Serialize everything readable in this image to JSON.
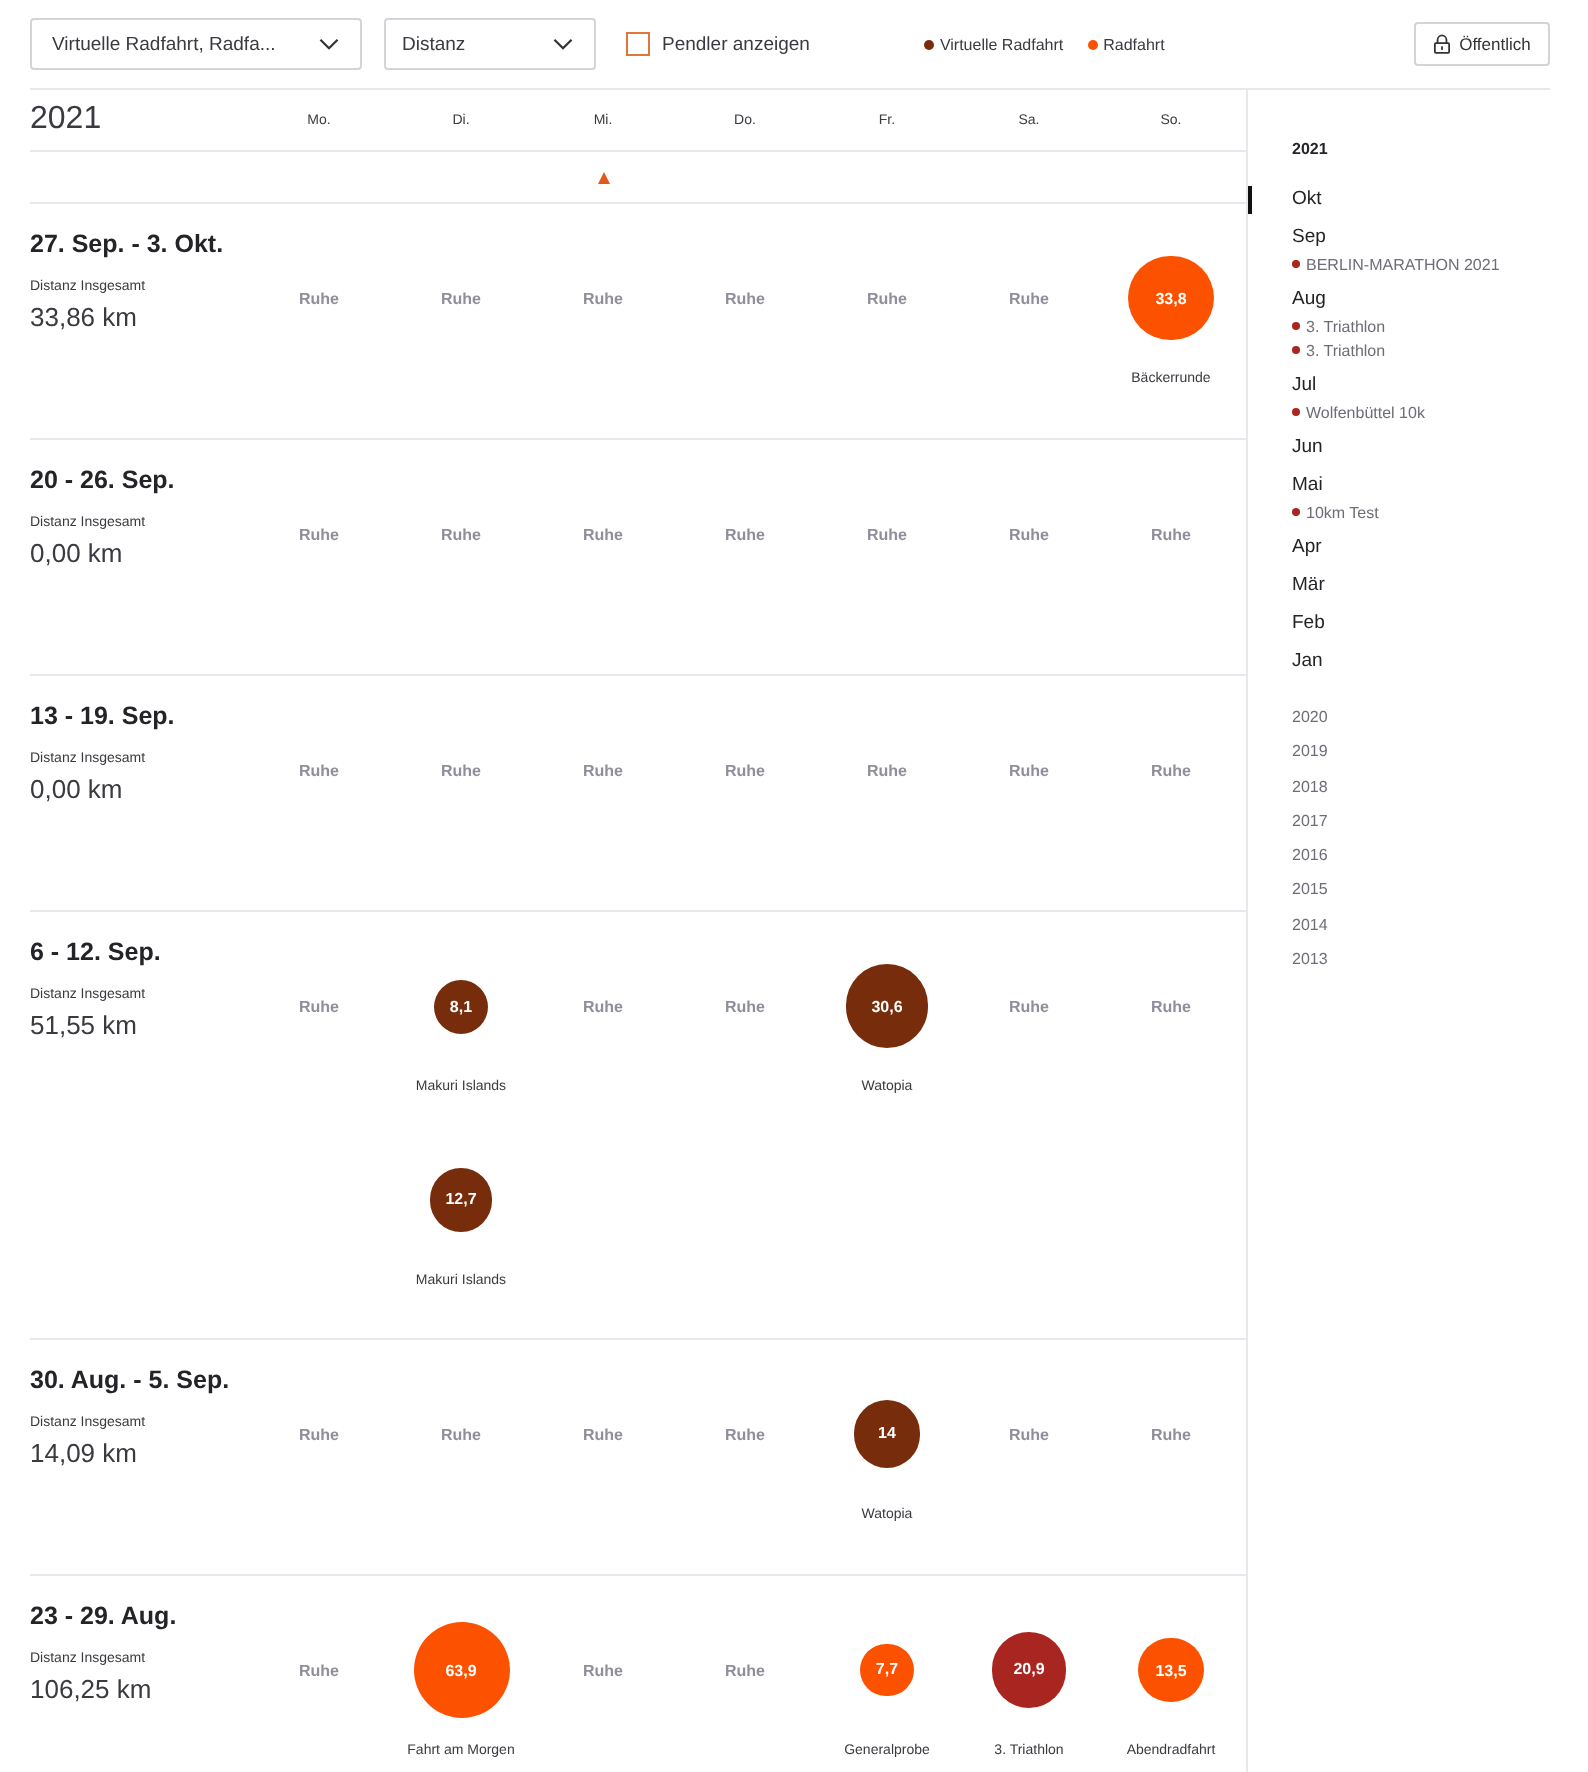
{
  "filters": {
    "activity_type": {
      "value": "Virtuelle Radfahrt, Radfa..."
    },
    "metric": {
      "value": "Distanz"
    },
    "commute": {
      "label": "Pendler anzeigen",
      "checked": false
    }
  },
  "legend": [
    {
      "label": "Virtuelle Radfahrt",
      "color": "#772d0b"
    },
    {
      "label": "Radfahrt",
      "color": "#fc5200"
    }
  ],
  "visibility_button": {
    "label": "Öffentlich"
  },
  "calendar": {
    "year": "2021",
    "weekdays": [
      {
        "label": "Mo.",
        "today": false
      },
      {
        "label": "Di.",
        "today": false
      },
      {
        "label": "Mi.",
        "today": true
      },
      {
        "label": "Do.",
        "today": false
      },
      {
        "label": "Fr.",
        "today": false
      },
      {
        "label": "Sa.",
        "today": false
      },
      {
        "label": "So.",
        "today": false
      }
    ],
    "weeks": [
      {
        "title": "27. Sep. - 3. Okt.",
        "total_label": "Distanz Insgesamt",
        "total": "33,86 km",
        "days": [
          {
            "kind": "rest",
            "label": "Ruhe"
          },
          {
            "kind": "rest",
            "label": "Ruhe"
          },
          {
            "kind": "rest",
            "label": "Ruhe"
          },
          {
            "kind": "rest",
            "label": "Ruhe"
          },
          {
            "kind": "rest",
            "label": "Ruhe"
          },
          {
            "kind": "rest",
            "label": "Ruhe"
          },
          {
            "kind": "activities",
            "activities": [
              {
                "value": "33,8",
                "name": "Bäckerrunde",
                "color": "#fc5200"
              }
            ]
          }
        ]
      },
      {
        "title": "20 - 26. Sep.",
        "total_label": "Distanz Insgesamt",
        "total": "0,00 km",
        "days": [
          {
            "kind": "rest",
            "label": "Ruhe"
          },
          {
            "kind": "rest",
            "label": "Ruhe"
          },
          {
            "kind": "rest",
            "label": "Ruhe"
          },
          {
            "kind": "rest",
            "label": "Ruhe"
          },
          {
            "kind": "rest",
            "label": "Ruhe"
          },
          {
            "kind": "rest",
            "label": "Ruhe"
          },
          {
            "kind": "rest",
            "label": "Ruhe"
          }
        ]
      },
      {
        "title": "13 - 19. Sep.",
        "total_label": "Distanz Insgesamt",
        "total": "0,00 km",
        "days": [
          {
            "kind": "rest",
            "label": "Ruhe"
          },
          {
            "kind": "rest",
            "label": "Ruhe"
          },
          {
            "kind": "rest",
            "label": "Ruhe"
          },
          {
            "kind": "rest",
            "label": "Ruhe"
          },
          {
            "kind": "rest",
            "label": "Ruhe"
          },
          {
            "kind": "rest",
            "label": "Ruhe"
          },
          {
            "kind": "rest",
            "label": "Ruhe"
          }
        ]
      },
      {
        "title": "6 - 12. Sep.",
        "total_label": "Distanz Insgesamt",
        "total": "51,55 km",
        "days": [
          {
            "kind": "rest",
            "label": "Ruhe"
          },
          {
            "kind": "activities",
            "activities": [
              {
                "value": "8,1",
                "name": "Makuri Islands",
                "color": "#772d0b"
              },
              {
                "value": "12,7",
                "name": "Makuri Islands",
                "color": "#772d0b"
              }
            ]
          },
          {
            "kind": "rest",
            "label": "Ruhe"
          },
          {
            "kind": "rest",
            "label": "Ruhe"
          },
          {
            "kind": "activities",
            "activities": [
              {
                "value": "30,6",
                "name": "Watopia",
                "color": "#772d0b"
              }
            ]
          },
          {
            "kind": "rest",
            "label": "Ruhe"
          },
          {
            "kind": "rest",
            "label": "Ruhe"
          }
        ]
      },
      {
        "title": "30. Aug. - 5. Sep.",
        "total_label": "Distanz Insgesamt",
        "total": "14,09 km",
        "days": [
          {
            "kind": "rest",
            "label": "Ruhe"
          },
          {
            "kind": "rest",
            "label": "Ruhe"
          },
          {
            "kind": "rest",
            "label": "Ruhe"
          },
          {
            "kind": "rest",
            "label": "Ruhe"
          },
          {
            "kind": "activities",
            "activities": [
              {
                "value": "14",
                "name": "Watopia",
                "color": "#772d0b"
              }
            ]
          },
          {
            "kind": "rest",
            "label": "Ruhe"
          },
          {
            "kind": "rest",
            "label": "Ruhe"
          }
        ]
      },
      {
        "title": "23 - 29. Aug.",
        "total_label": "Distanz Insgesamt",
        "total": "106,25 km",
        "days": [
          {
            "kind": "rest",
            "label": "Ruhe"
          },
          {
            "kind": "activities",
            "activities": [
              {
                "value": "63,9",
                "name": "Fahrt am Morgen",
                "color": "#fc5200"
              }
            ]
          },
          {
            "kind": "rest",
            "label": "Ruhe"
          },
          {
            "kind": "rest",
            "label": "Ruhe"
          },
          {
            "kind": "activities",
            "activities": [
              {
                "value": "7,7",
                "name": "Generalprobe",
                "color": "#fc5200"
              }
            ]
          },
          {
            "kind": "activities",
            "activities": [
              {
                "value": "20,9",
                "name": "3. Triathlon",
                "color": "#a8261f"
              }
            ]
          },
          {
            "kind": "activities",
            "activities": [
              {
                "value": "13,5",
                "name": "Abendradfahrt",
                "color": "#fc5200"
              }
            ]
          }
        ]
      }
    ]
  },
  "sidebar": {
    "year": "2021",
    "months": [
      {
        "label": "Okt",
        "selected": true
      },
      {
        "label": "Sep",
        "selected": false,
        "events": [
          {
            "label": "BERLIN-MARATHON 2021"
          }
        ]
      },
      {
        "label": "Aug",
        "selected": false,
        "events": [
          {
            "label": "3. Triathlon"
          },
          {
            "label": "3. Triathlon"
          }
        ]
      },
      {
        "label": "Jul",
        "selected": false,
        "events": [
          {
            "label": "Wolfenbüttel 10k"
          }
        ]
      },
      {
        "label": "Jun",
        "selected": false
      },
      {
        "label": "Mai",
        "selected": false,
        "events": [
          {
            "label": "10km Test"
          }
        ]
      },
      {
        "label": "Apr",
        "selected": false
      },
      {
        "label": "Mär",
        "selected": false
      },
      {
        "label": "Feb",
        "selected": false
      },
      {
        "label": "Jan",
        "selected": false
      }
    ],
    "years": [
      {
        "label": "2020"
      },
      {
        "label": "2019"
      },
      {
        "label": "2018"
      },
      {
        "label": "2017"
      },
      {
        "label": "2016"
      },
      {
        "label": "2015"
      },
      {
        "label": "2014"
      },
      {
        "label": "2013"
      }
    ]
  }
}
